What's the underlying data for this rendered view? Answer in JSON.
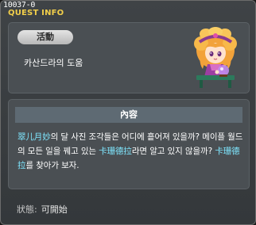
{
  "window": {
    "id": "10037-0",
    "title": "QUEST INFO"
  },
  "quest": {
    "type_badge": "活動",
    "name": "카산드라의 도움",
    "npc_icon": "npc-girl-crystal-ball-icon"
  },
  "content": {
    "header": "內容",
    "segments": [
      {
        "text": "翠儿月妙",
        "highlight": true
      },
      {
        "text": "의 달 사진 조각들은 어디에 흩어져 있을까? 메이플 월드의 모든 일을 꿰고 있는 ",
        "highlight": false
      },
      {
        "text": "卡珊德拉",
        "highlight": true
      },
      {
        "text": "라면 알고 있지 않을까? ",
        "highlight": false
      },
      {
        "text": "卡珊德拉",
        "highlight": true
      },
      {
        "text": "를 찾아가 보자.",
        "highlight": false
      }
    ]
  },
  "status": {
    "label": "狀態:",
    "value": "可開始"
  },
  "colors": {
    "title": "#f2cf4a",
    "highlight": "#7fe7ff",
    "panel": "#4a4f53",
    "header_bar": "#5e6a73"
  }
}
